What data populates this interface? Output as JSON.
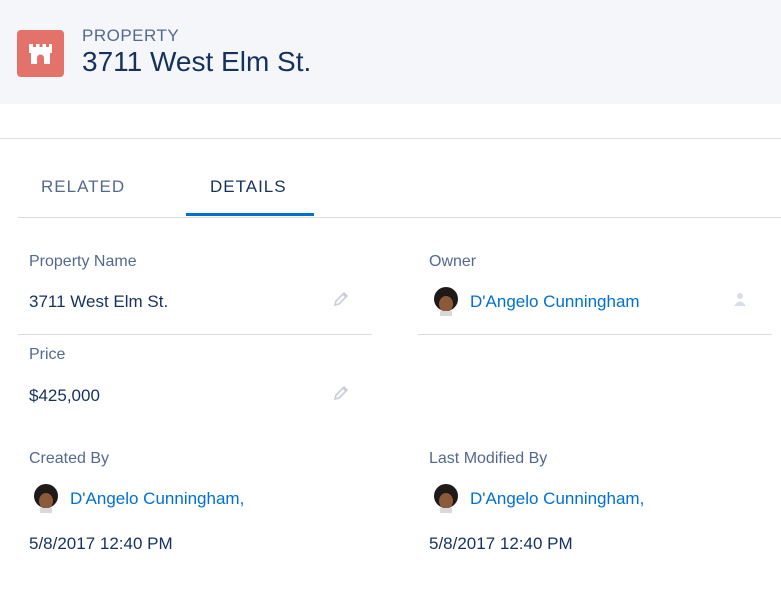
{
  "header": {
    "object_type": "PROPERTY",
    "title": "3711 West Elm St.",
    "icon": "castle-icon",
    "icon_color": "#e3736a"
  },
  "tabs": [
    {
      "label": "RELATED",
      "active": false
    },
    {
      "label": "DETAILS",
      "active": true
    }
  ],
  "fields": {
    "property_name": {
      "label": "Property Name",
      "value": "3711 West Elm St."
    },
    "owner": {
      "label": "Owner",
      "value": "D'Angelo Cunningham"
    },
    "price": {
      "label": "Price",
      "value": "$425,000"
    },
    "created_by": {
      "label": "Created By",
      "user": "D'Angelo Cunningham,",
      "date": "5/8/2017 12:40 PM"
    },
    "last_modified_by": {
      "label": "Last Modified By",
      "user": "D'Angelo Cunningham,",
      "date": "5/8/2017 12:40 PM"
    }
  },
  "colors": {
    "accent": "#0070d2",
    "text": "#16325c",
    "label": "#54698d",
    "header_bg": "#f4f6f9"
  }
}
